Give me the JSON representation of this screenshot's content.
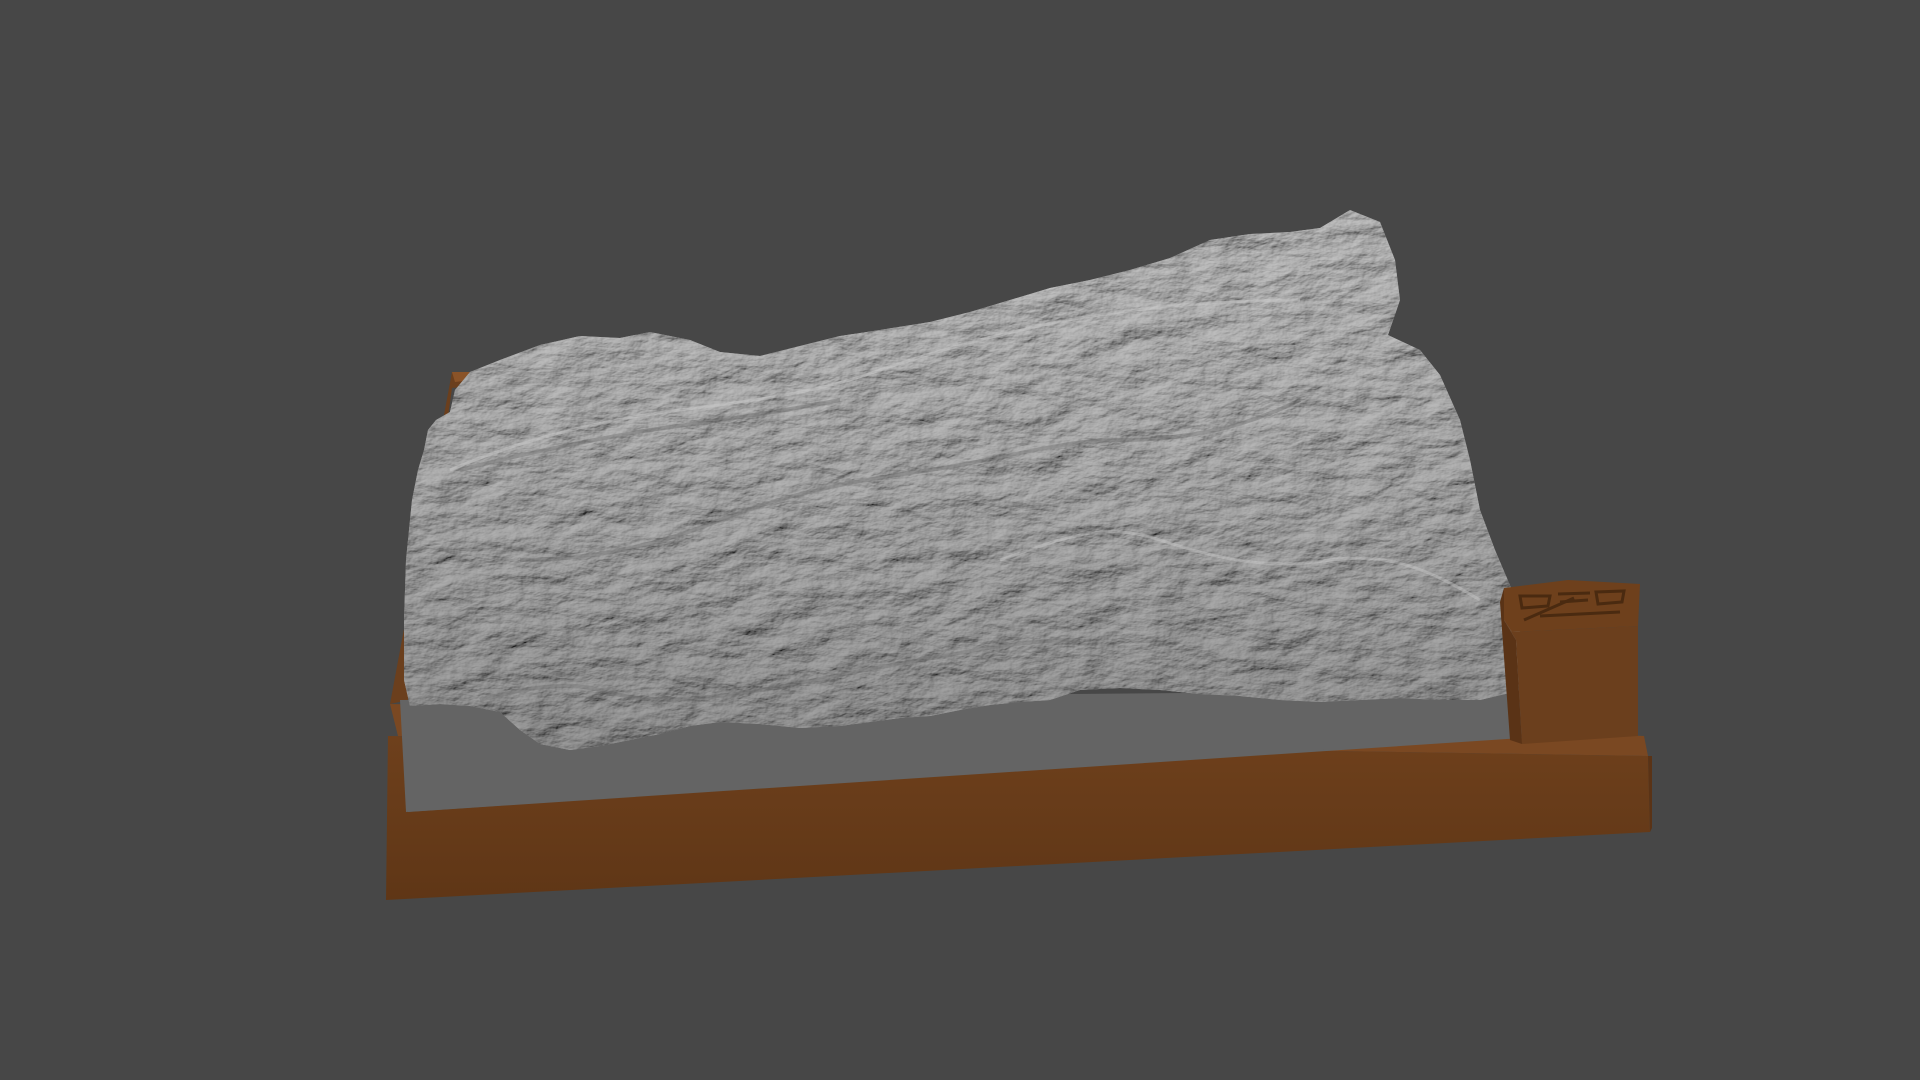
{
  "scene": {
    "background_color": "#474747",
    "frame_color": "#6b3f1d",
    "frame_shadow_color": "#5a3316",
    "frame_highlight_color": "#8a5328",
    "plinth_color": "#646464",
    "terrain_color": "#9e9e9e",
    "terrain_light_color": "#c4c4c4",
    "terrain_dark_color": "#6c6c6c",
    "icon_names": [
      "terrain-model",
      "wooden-frame",
      "label-block"
    ]
  }
}
